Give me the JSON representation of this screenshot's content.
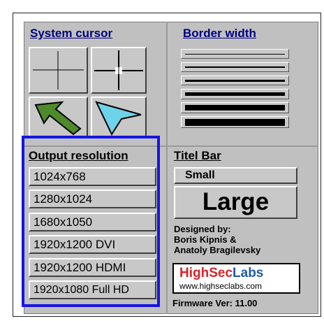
{
  "cursor_section": {
    "title": "System cursor"
  },
  "border_section": {
    "title": "Border width"
  },
  "resolution_section": {
    "title": "Output resolution",
    "options": [
      "1024x768",
      "1280x1024",
      "1680x1050",
      "1920x1200 DVI",
      "1920x1200 HDMI",
      "1920x1080 Full HD"
    ]
  },
  "titlebar_section": {
    "title": "Titel Bar",
    "small_label": "Small",
    "large_label": "Large"
  },
  "credits": {
    "line1": "Designed by:",
    "line2": "Boris Kipnis &",
    "line3": "Anatoly Bragilevsky"
  },
  "logo": {
    "brand_red": "HighSec",
    "brand_blue": "Labs",
    "url": "www.highseclabs.com"
  },
  "firmware": "Firmware Ver: 11.00",
  "colors": {
    "panel": "#c0c0c0",
    "header": "#000080",
    "selection": "#1515e6",
    "green_cursor": "#4e8a2c",
    "cyan_cursor": "#6ed3e8"
  }
}
